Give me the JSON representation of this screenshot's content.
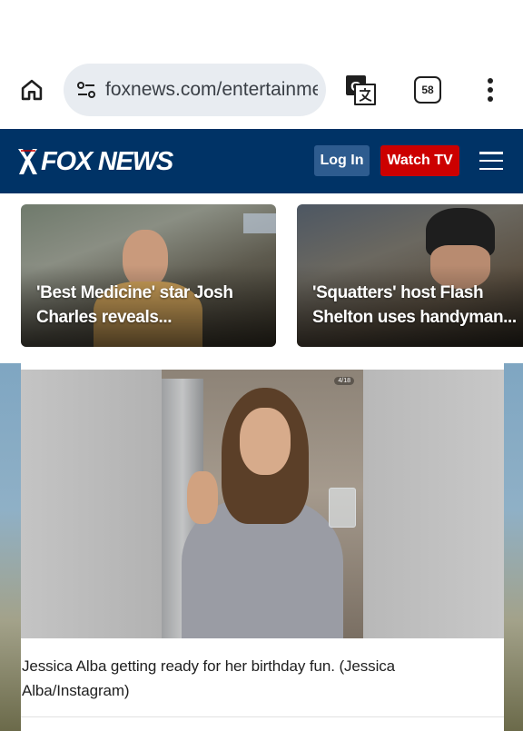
{
  "browser": {
    "url": "foxnews.com/entertainment",
    "tab_count": "58",
    "icons": {
      "home": "home-icon",
      "site_info": "tune-icon",
      "translate": "translate-icon",
      "menu": "more-vert-icon"
    }
  },
  "header": {
    "logo_text": "FOX NEWS",
    "login_label": "Log In",
    "watch_label": "Watch TV",
    "colors": {
      "bar": "#003366",
      "login": "#2e5c8f",
      "watch": "#cc0000"
    }
  },
  "stories": [
    {
      "title": "'Best Medicine' star Josh Charles reveals..."
    },
    {
      "title": "'Squatters' host Flash Shelton uses handyman..."
    }
  ],
  "gallery": {
    "counter": "4/18",
    "caption": "Jessica Alba getting ready for her birthday fun. (Jessica Alba/Instagram)"
  }
}
